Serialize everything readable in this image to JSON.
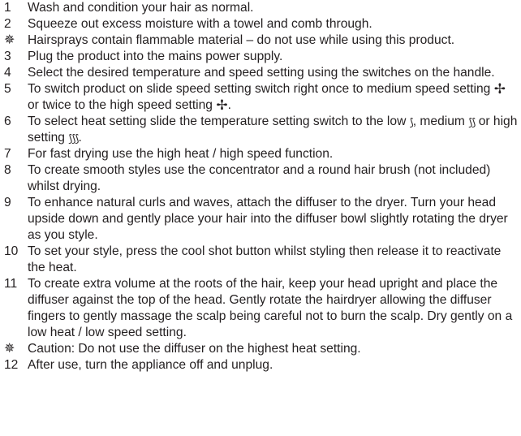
{
  "steps": [
    {
      "marker": "1",
      "type": "number",
      "parts": [
        {
          "t": "Wash and condition your hair as normal."
        }
      ]
    },
    {
      "marker": "2",
      "type": "number",
      "parts": [
        {
          "t": "Squeeze out excess moisture with a towel and comb through."
        }
      ]
    },
    {
      "marker": "✵",
      "type": "warning",
      "parts": [
        {
          "t": "Hairsprays contain flammable material – do not use while using this product."
        }
      ]
    },
    {
      "marker": "3",
      "type": "number",
      "parts": [
        {
          "t": "Plug the product into the mains power supply."
        }
      ]
    },
    {
      "marker": "4",
      "type": "number",
      "parts": [
        {
          "t": "Select the desired temperature and speed setting using the switches on the handle."
        }
      ]
    },
    {
      "marker": "5",
      "type": "number",
      "parts": [
        {
          "t": "To switch product on slide speed setting switch right once to medium speed setting "
        },
        {
          "g": "✢",
          "name": "fan-medium-icon",
          "cls": "glyph"
        },
        {
          "t": " or twice to the high speed setting "
        },
        {
          "g": "✢",
          "name": "fan-high-icon",
          "cls": "glyph"
        },
        {
          "t": "."
        }
      ]
    },
    {
      "marker": "6",
      "type": "number",
      "parts": [
        {
          "t": "To select heat setting slide the temperature setting switch to the low "
        },
        {
          "g": "⟆",
          "name": "heat-low-icon",
          "cls": "glyph heat"
        },
        {
          "t": ", medium "
        },
        {
          "g": "⟆⟆",
          "name": "heat-medium-icon",
          "cls": "glyph heat"
        },
        {
          "t": " or high setting "
        },
        {
          "g": "⟆⟆⟆",
          "name": "heat-high-icon",
          "cls": "glyph heat"
        },
        {
          "t": "."
        }
      ]
    },
    {
      "marker": "7",
      "type": "number",
      "parts": [
        {
          "t": "For fast drying use the high heat / high speed function."
        }
      ]
    },
    {
      "marker": "8",
      "type": "number",
      "parts": [
        {
          "t": "To create smooth styles use the concentrator and a round hair brush (not included) whilst drying."
        }
      ]
    },
    {
      "marker": "9",
      "type": "number",
      "parts": [
        {
          "t": "To enhance natural curls and waves, attach the diffuser to the dryer. Turn your head upside down and gently place your hair into the diffuser bowl slightly rotating the dryer as you style."
        }
      ]
    },
    {
      "marker": "10",
      "type": "number",
      "parts": [
        {
          "t": "To set your style, press the cool shot button whilst styling then release it to reactivate the heat."
        }
      ]
    },
    {
      "marker": "11",
      "type": "number",
      "parts": [
        {
          "t": "To create extra volume at the roots of the hair, keep your head upright and place the diffuser against the top of the head. Gently rotate the hairdryer allowing the diffuser fingers to gently massage the scalp being careful not to burn the scalp. Dry gently on a low heat / low speed setting."
        }
      ]
    },
    {
      "marker": "✵",
      "type": "warning",
      "parts": [
        {
          "t": "Caution: Do not use the diffuser on the highest heat setting."
        }
      ]
    },
    {
      "marker": "12",
      "type": "number",
      "parts": [
        {
          "t": "After use, turn the appliance off and unplug."
        }
      ]
    }
  ]
}
